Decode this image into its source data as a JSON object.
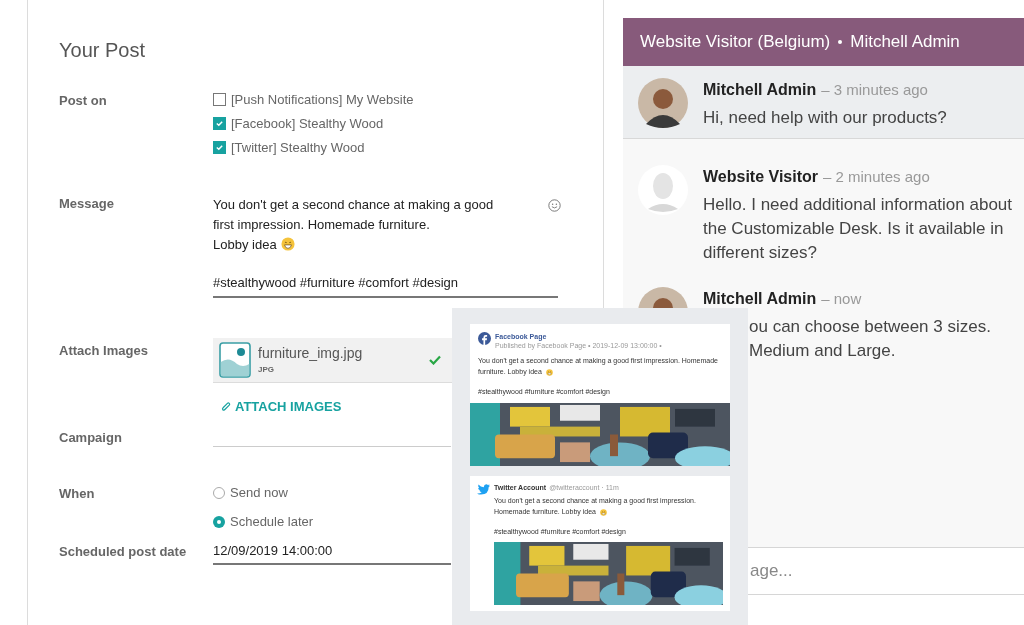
{
  "post_form": {
    "title": "Your Post",
    "post_on": {
      "label": "Post on",
      "accounts": [
        {
          "label": "[Push Notifications] My Website",
          "checked": false
        },
        {
          "label": "[Facebook] Stealthy Wood",
          "checked": true
        },
        {
          "label": "[Twitter] Stealthy Wood",
          "checked": true
        }
      ]
    },
    "message": {
      "label": "Message",
      "lines": [
        "You don't get a second chance at making a good",
        "first impression. Homemade furniture.",
        "Lobby idea"
      ],
      "hashtags": "#stealthywood #furniture #comfort #design"
    },
    "attach_images": {
      "label": "Attach Images",
      "file": {
        "name": "furniture_img.jpg",
        "type": "JPG",
        "uploaded": true
      },
      "button": "ATTACH IMAGES"
    },
    "campaign": {
      "label": "Campaign"
    },
    "when": {
      "label": "When",
      "options": [
        {
          "label": "Send now",
          "selected": false
        },
        {
          "label": "Schedule later",
          "selected": true
        }
      ]
    },
    "scheduled_post_date": {
      "label": "Scheduled post date",
      "value": "12/09/2019 14:00:00"
    }
  },
  "chat": {
    "title": "Website Visitor (Belgium)",
    "agent": "Mitchell Admin",
    "messages": [
      {
        "author": "Mitchell Admin",
        "time": "– 3 minutes ago",
        "text": "Hi, need help with our products?",
        "kind": "agent",
        "highlighted": true,
        "covered": false
      },
      {
        "author": "Website Visitor",
        "time": "– 2 minutes ago",
        "text": "Hello. I need additional information about the Customizable Desk. Is it available in different sizes?",
        "kind": "visitor",
        "highlighted": false,
        "covered": false
      },
      {
        "author": "Mitchell Admin",
        "time": "– now",
        "text": "ou can choose between 3 sizes.\nMedium and Large.",
        "kind": "agent",
        "highlighted": false,
        "covered": true
      }
    ],
    "input": {
      "placeholder": "age..."
    }
  },
  "preview": {
    "facebook": {
      "page": "Facebook Page",
      "published": "Published by Facebook Page • 2019-12-09 13:00:00 •",
      "text": "You don't get a second chance at making a good first impression. Homemade furniture. Lobby idea",
      "hashtags": "#stealthywood #furniture #comfort #design"
    },
    "twitter": {
      "account": "Twitter Account",
      "handle": "@twitteraccount · 11m",
      "text": "You don't get a second chance at making a good first impression. Homemade furniture. Lobby idea",
      "hashtags": "#stealthywood #furniture #comfort #design"
    }
  }
}
